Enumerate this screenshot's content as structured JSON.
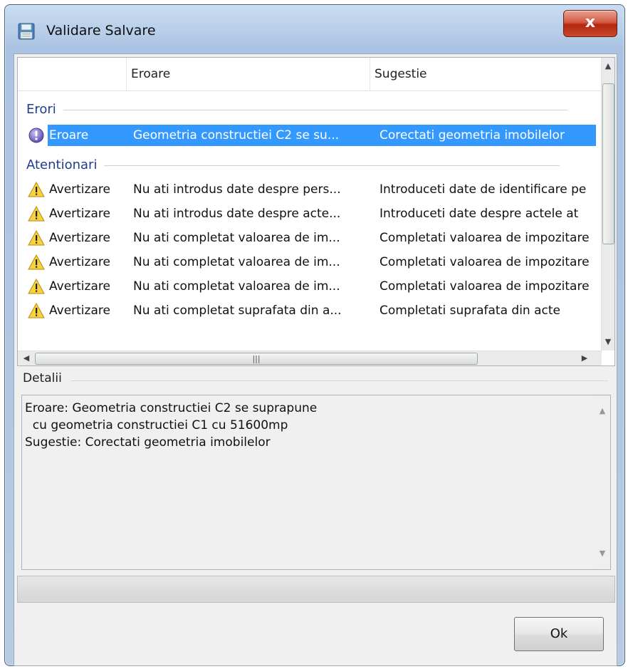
{
  "window": {
    "title": "Validare Salvare",
    "close_label": "x"
  },
  "list": {
    "columns": [
      "Eroare",
      "Sugestie"
    ],
    "groups": [
      {
        "header": "Erori",
        "rows": [
          {
            "icon": "error-icon",
            "type": "Eroare",
            "error": "Geometria constructiei C2 se su...",
            "suggestion": "Corectati geometria imobilelor",
            "selected": true
          }
        ]
      },
      {
        "header": "Atentionari",
        "rows": [
          {
            "icon": "warning-icon",
            "type": "Avertizare",
            "error": "Nu ati introdus date despre pers...",
            "suggestion": "Introduceti date de identificare pe"
          },
          {
            "icon": "warning-icon",
            "type": "Avertizare",
            "error": "Nu ati introdus date despre acte...",
            "suggestion": "Introduceti date despre actele at"
          },
          {
            "icon": "warning-icon",
            "type": "Avertizare",
            "error": "Nu ati completat valoarea de im...",
            "suggestion": "Completati valoarea de impozitare"
          },
          {
            "icon": "warning-icon",
            "type": "Avertizare",
            "error": "Nu ati completat valoarea de im...",
            "suggestion": "Completati valoarea de impozitare"
          },
          {
            "icon": "warning-icon",
            "type": "Avertizare",
            "error": "Nu ati completat valoarea de im...",
            "suggestion": "Completati valoarea de impozitare"
          },
          {
            "icon": "warning-icon",
            "type": "Avertizare",
            "error": "Nu ati completat suprafata din a...",
            "suggestion": "Completati suprafata din acte"
          }
        ]
      }
    ]
  },
  "details": {
    "label": "Detalii",
    "text": "Eroare: Geometria constructiei C2 se suprapune\n  cu geometria constructiei C1 cu 51600mp\nSugestie: Corectati geometria imobilelor"
  },
  "buttons": {
    "ok": "Ok"
  },
  "colors": {
    "selection": "#3399ff",
    "group_header": "#1e3e8c",
    "close_button": "#c8432a"
  }
}
